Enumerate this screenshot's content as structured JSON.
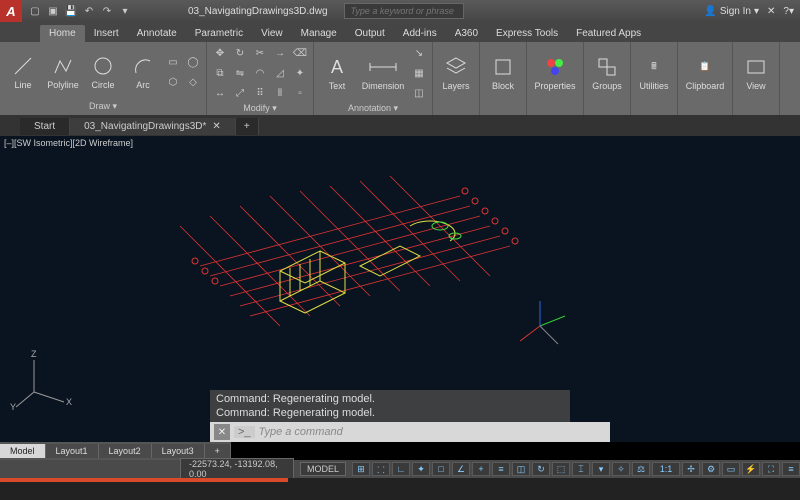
{
  "title": "03_NavigatingDrawings3D.dwg",
  "search_placeholder": "Type a keyword or phrase",
  "signin_label": "Sign In",
  "ribbon_tabs": [
    "Home",
    "Insert",
    "Annotate",
    "Parametric",
    "View",
    "Manage",
    "Output",
    "Add-ins",
    "A360",
    "Express Tools",
    "Featured Apps"
  ],
  "active_ribbon_tab": 0,
  "panels": {
    "draw": {
      "label": "Draw ▾",
      "buttons": [
        "Line",
        "Polyline",
        "Circle",
        "Arc"
      ]
    },
    "modify": {
      "label": "Modify ▾"
    },
    "annotation": {
      "label": "Annotation ▾",
      "buttons": [
        "Text",
        "Dimension"
      ]
    },
    "layers": {
      "label": "Layers"
    },
    "block": {
      "label": "Block"
    },
    "properties": {
      "label": "Properties"
    },
    "groups": {
      "label": "Groups"
    },
    "utilities": {
      "label": "Utilities"
    },
    "clipboard": {
      "label": "Clipboard"
    },
    "view": {
      "label": "View"
    }
  },
  "doc_tabs": {
    "start": "Start",
    "file": "03_NavigatingDrawings3D*"
  },
  "viewport_label": "[–][SW Isometric][2D Wireframe]",
  "ucs": {
    "x": "X",
    "y": "Y",
    "z": "Z"
  },
  "cmd_history": [
    "Command:  Regenerating model.",
    "Command:  Regenerating model."
  ],
  "cmd_prompt": ">_",
  "cmd_placeholder": "Type a command",
  "layout_tabs": [
    "Model",
    "Layout1",
    "Layout2",
    "Layout3"
  ],
  "active_layout_tab": 0,
  "coords": "-22573.24, -13192.08, 0.00",
  "model_badge": "MODEL",
  "scale_label": "1:1"
}
